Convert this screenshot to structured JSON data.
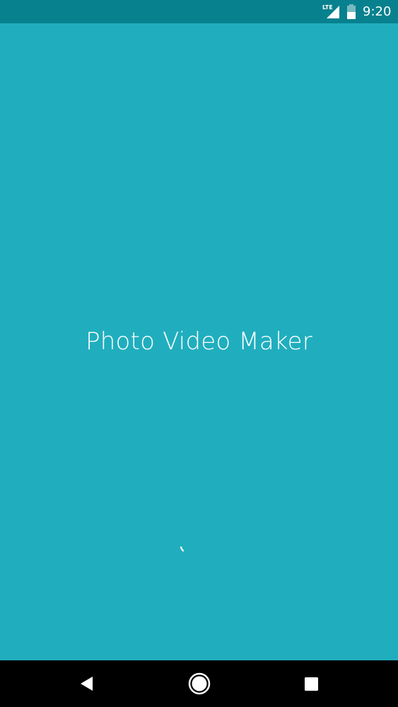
{
  "status_bar": {
    "network_label": "LTE",
    "signal_icon": "signal-lte-icon",
    "battery_icon": "battery-icon",
    "time": "9:20"
  },
  "splash": {
    "title": "Photo Video Maker",
    "loading_icon": "loading-spinner-icon"
  },
  "nav_bar": {
    "back_icon": "back-triangle-icon",
    "home_icon": "home-circle-icon",
    "recents_icon": "recents-square-icon"
  },
  "colors": {
    "background": "#20AEBE",
    "status_bar": "#08818E",
    "nav_bar": "#000000",
    "foreground": "#FFFFFF"
  }
}
